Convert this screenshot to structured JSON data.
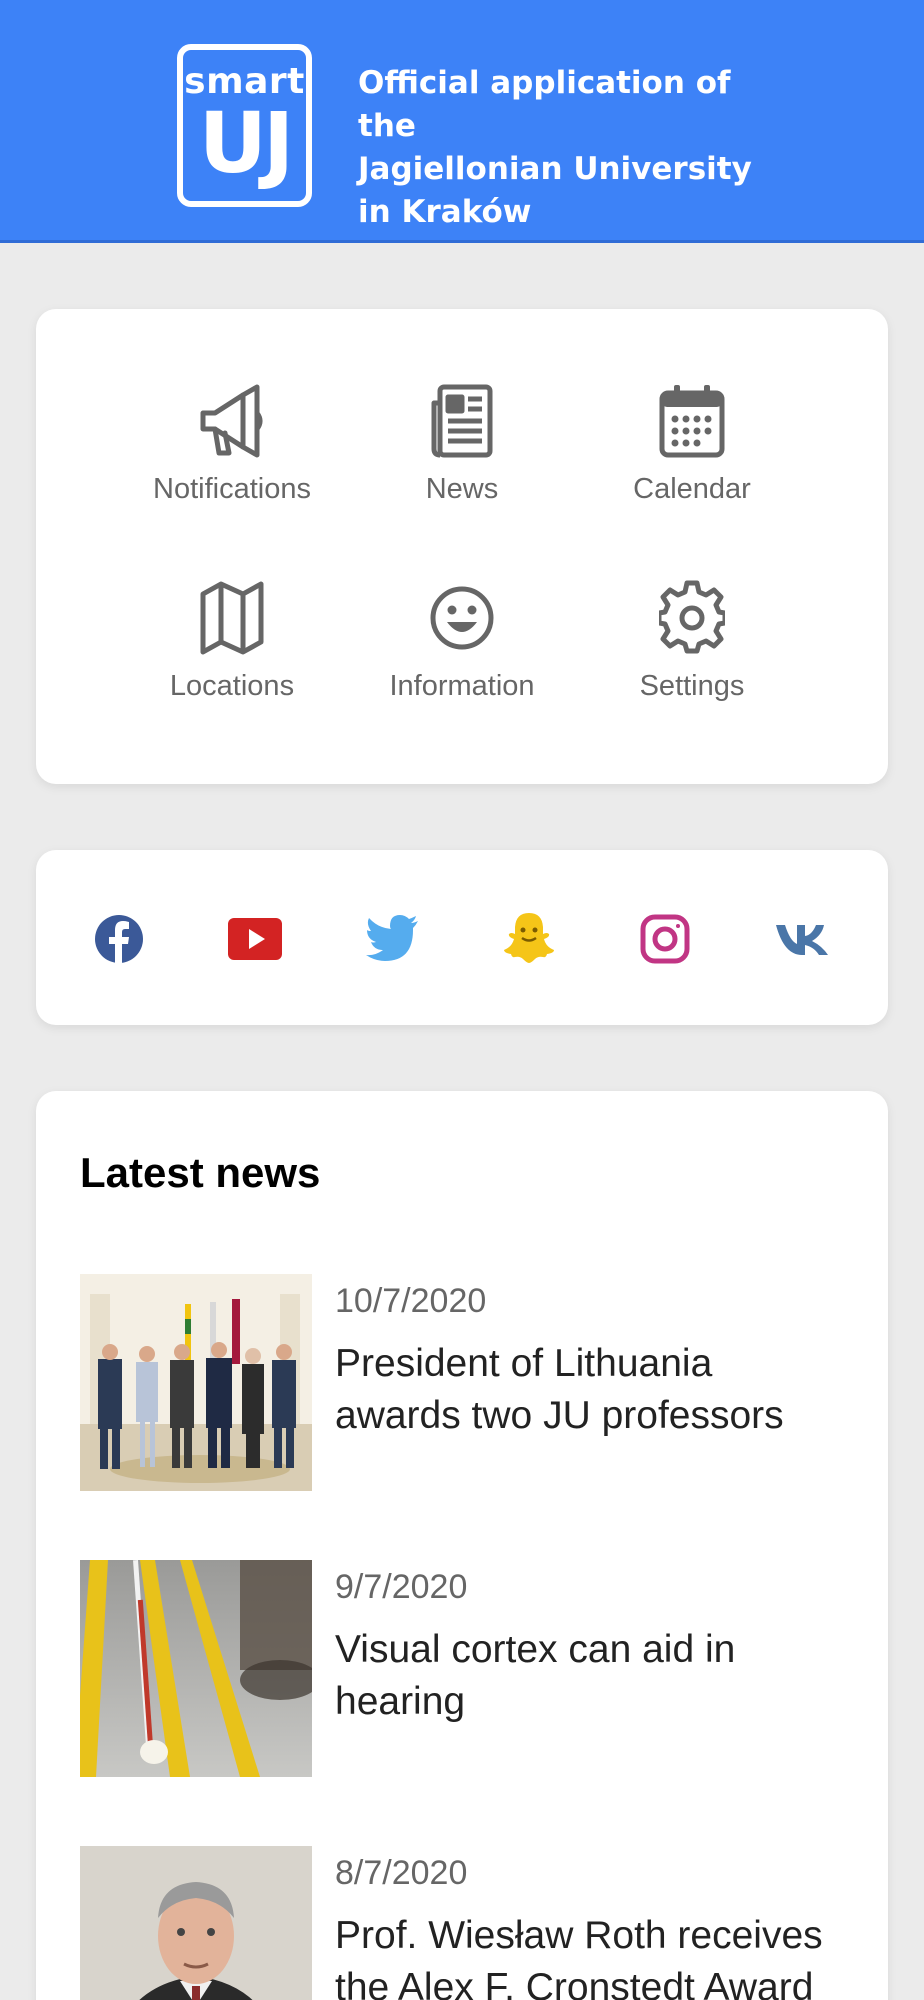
{
  "header": {
    "logo_top": "smart",
    "logo_main": "UJ",
    "tagline_line1": "Official application of the",
    "tagline_line2": "Jagiellonian University",
    "tagline_line3": "in Kraków",
    "bg_color": "#3d82f7"
  },
  "menu": {
    "items": [
      {
        "label": "Notifications",
        "icon": "megaphone-icon"
      },
      {
        "label": "News",
        "icon": "newspaper-icon"
      },
      {
        "label": "Calendar",
        "icon": "calendar-icon"
      },
      {
        "label": "Locations",
        "icon": "map-icon"
      },
      {
        "label": "Information",
        "icon": "smiley-icon"
      },
      {
        "label": "Settings",
        "icon": "gear-icon"
      }
    ],
    "icon_color": "#666666"
  },
  "social": {
    "items": [
      {
        "name": "facebook-icon",
        "color": "#3b5998"
      },
      {
        "name": "youtube-icon",
        "color": "#d32323"
      },
      {
        "name": "twitter-icon",
        "color": "#55acee"
      },
      {
        "name": "snapchat-icon",
        "color": "#f5c518"
      },
      {
        "name": "instagram-icon",
        "color": "#c13584"
      },
      {
        "name": "vk-icon",
        "color": "#4a76a8"
      }
    ]
  },
  "news": {
    "title": "Latest news",
    "items": [
      {
        "date": "10/7/2020",
        "headline": "President of Lithuania awards two JU professors"
      },
      {
        "date": "9/7/2020",
        "headline": "Visual cortex can aid in hearing"
      },
      {
        "date": "8/7/2020",
        "headline": "Prof. Wiesław Roth receives the Alex F. Cronstedt Award"
      }
    ]
  }
}
